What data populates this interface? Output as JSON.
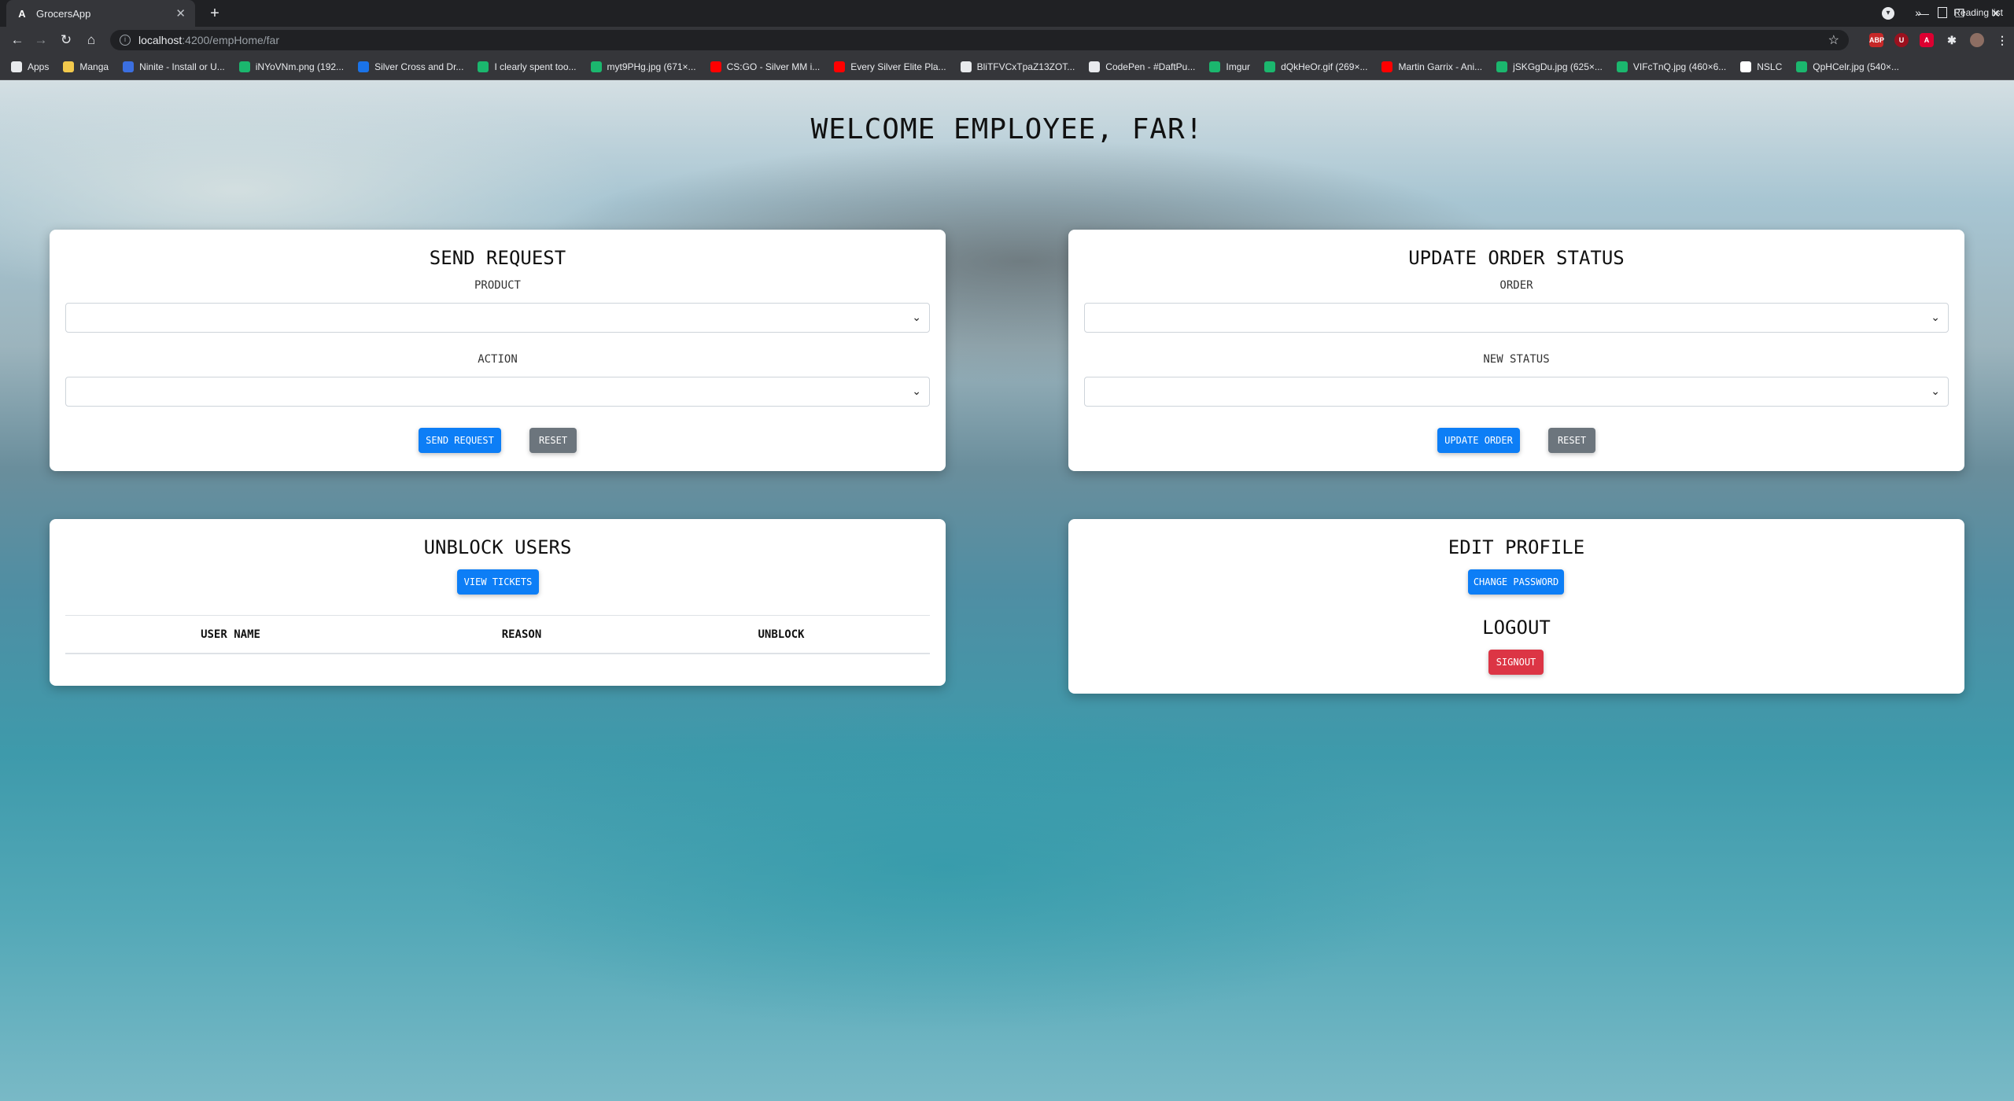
{
  "browser": {
    "tab_title": "GrocersApp",
    "url_host": "localhost",
    "url_path": ":4200/empHome/far",
    "reading_list": "Reading list",
    "bookmarks": [
      {
        "label": "Apps",
        "color": "#e8eaed"
      },
      {
        "label": "Manga",
        "color": "#f2c94c"
      },
      {
        "label": "Ninite - Install or U...",
        "color": "#3b6fe0"
      },
      {
        "label": "iNYoVNm.png (192...",
        "color": "#1bb76e"
      },
      {
        "label": "Silver Cross and Dr...",
        "color": "#1a73e8"
      },
      {
        "label": "I clearly spent too...",
        "color": "#1bb76e"
      },
      {
        "label": "myt9PHg.jpg (671×...",
        "color": "#1bb76e"
      },
      {
        "label": "CS:GO - Silver MM i...",
        "color": "#ff0000"
      },
      {
        "label": "Every Silver Elite Pla...",
        "color": "#ff0000"
      },
      {
        "label": "BliTFVCxTpaZ13ZOT...",
        "color": "#e8eaed"
      },
      {
        "label": "CodePen - #DaftPu...",
        "color": "#e8eaed"
      },
      {
        "label": "Imgur",
        "color": "#1bb76e"
      },
      {
        "label": "dQkHeOr.gif (269×...",
        "color": "#1bb76e"
      },
      {
        "label": "Martin Garrix - Ani...",
        "color": "#ff0000"
      },
      {
        "label": "jSKGgDu.jpg (625×...",
        "color": "#1bb76e"
      },
      {
        "label": "VIFcTnQ.jpg (460×6...",
        "color": "#1bb76e"
      },
      {
        "label": "NSLC",
        "color": "#ffffff"
      },
      {
        "label": "QpHCelr.jpg (540×...",
        "color": "#1bb76e"
      }
    ]
  },
  "page": {
    "welcome": "WELCOME EMPLOYEE, FAR!"
  },
  "send_request": {
    "title": "SEND REQUEST",
    "product_label": "PRODUCT",
    "product_value": "",
    "action_label": "ACTION",
    "action_value": "",
    "send_button": "SEND REQUEST",
    "reset_button": "RESET"
  },
  "update_order": {
    "title": "UPDATE ORDER STATUS",
    "order_label": "ORDER",
    "order_value": "",
    "status_label": "NEW STATUS",
    "status_value": "",
    "update_button": "UPDATE ORDER",
    "reset_button": "RESET"
  },
  "unblock_users": {
    "title": "UNBLOCK USERS",
    "view_button": "VIEW TICKETS",
    "columns": [
      "USER NAME",
      "REASON",
      "UNBLOCK"
    ]
  },
  "edit_profile": {
    "title": "EDIT PROFILE",
    "change_password_button": "CHANGE PASSWORD",
    "logout_title": "LOGOUT",
    "signout_button": "SIGNOUT"
  },
  "colors": {
    "primary": "#0d7ef6",
    "secondary": "#6c757d",
    "danger": "#dc3545"
  }
}
